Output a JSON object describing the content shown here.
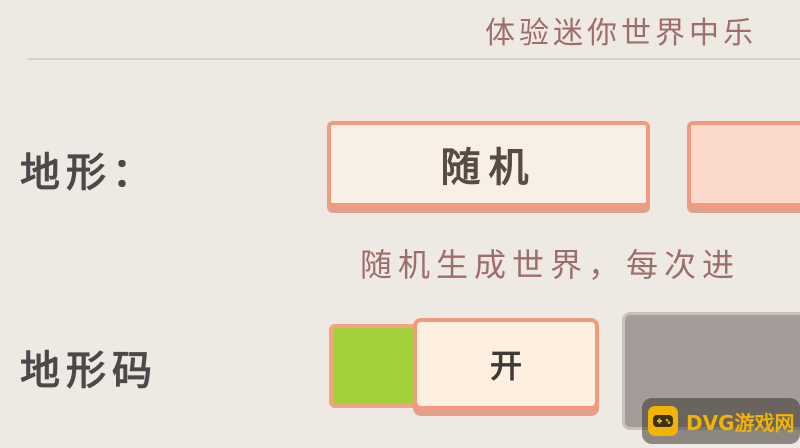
{
  "header": {
    "caption": "体验迷你世界中乐"
  },
  "terrain": {
    "label": "地形：",
    "selected_option": "随机",
    "description": "随机生成世界，每次进"
  },
  "terrain_code": {
    "label": "地形码",
    "toggle_label": "开",
    "toggle_state": "on"
  },
  "watermark": {
    "text": "DVG游戏网"
  },
  "colors": {
    "background": "#efe9e4",
    "accent_border": "#f19a7d",
    "toggle_on": "#a3d13a",
    "caption_text": "#9c6f6b"
  }
}
